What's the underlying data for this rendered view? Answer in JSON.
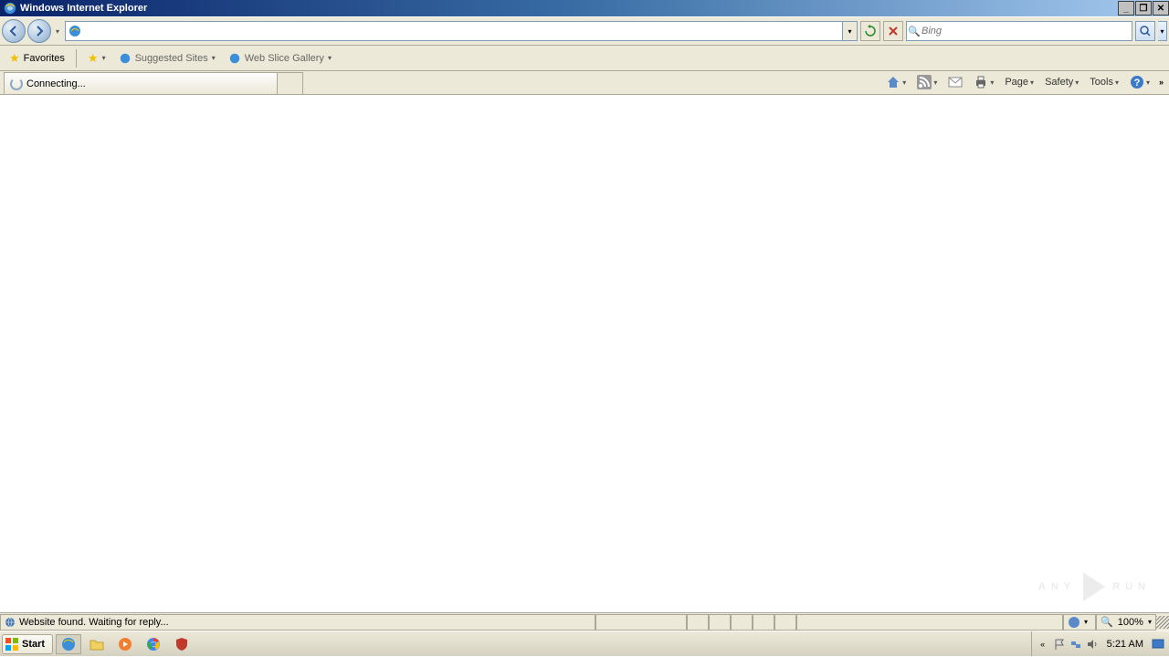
{
  "window": {
    "title": "Windows Internet Explorer"
  },
  "address": {
    "value": ""
  },
  "search": {
    "placeholder": "Bing"
  },
  "favorites": {
    "label": "Favorites",
    "suggested": "Suggested Sites",
    "webslice": "Web Slice Gallery"
  },
  "tab": {
    "label": "Connecting..."
  },
  "commands": {
    "page": "Page",
    "safety": "Safety",
    "tools": "Tools"
  },
  "status": {
    "text": "Website found. Waiting for reply...",
    "zoom": "100%"
  },
  "taskbar": {
    "start": "Start",
    "clock": "5:21 AM"
  },
  "watermark": {
    "a": "ANY",
    "b": "RUN"
  }
}
